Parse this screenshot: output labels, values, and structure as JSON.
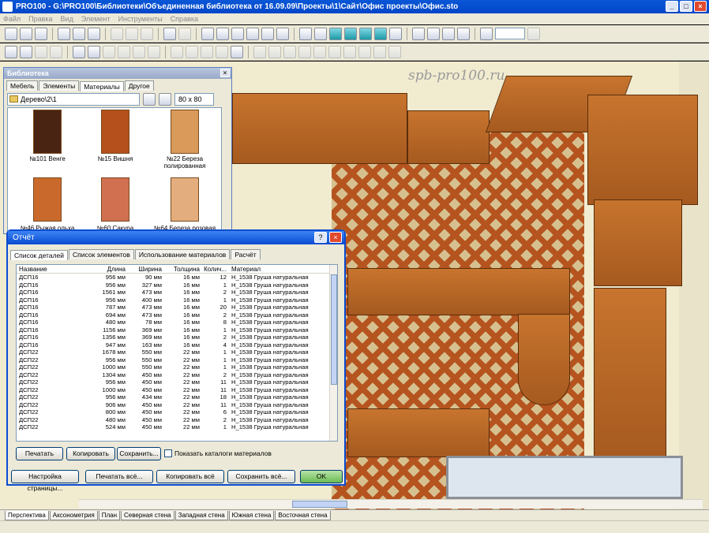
{
  "window": {
    "title": "PRO100 - G:\\PRO100\\Библиотеки\\Объединенная библиотека от 16.09.09\\Проекты\\1\\Сайт\\Офис проекты\\Офис.sto"
  },
  "menu": [
    "Файл",
    "Правка",
    "Вид",
    "Элемент",
    "Инструменты",
    "Справка"
  ],
  "watermark": "spb-pro100.ru",
  "library": {
    "title": "Библиотека",
    "tabs": [
      "Мебель",
      "Элементы",
      "Материалы",
      "Другое"
    ],
    "path": "Дерево\\2\\1",
    "thumb_size": "80 x 80",
    "swatches": [
      {
        "label": "№101 Венге",
        "color": "#4a2412"
      },
      {
        "label": "№15 Вишня",
        "color": "#b5501c"
      },
      {
        "label": "№22 Береза полированная",
        "color": "#d99a5a"
      },
      {
        "label": "№46 Рыжая ольха",
        "color": "#c96a2c"
      },
      {
        "label": "№60 Сакура",
        "color": "#d07050"
      },
      {
        "label": "№64 Береза розовая",
        "color": "#e3ad7e"
      }
    ]
  },
  "report": {
    "title": "Отчёт",
    "tabs": [
      "Список деталей",
      "Список элементов",
      "Использование материалов",
      "Расчёт"
    ],
    "columns": [
      "Название",
      "Длина",
      "Ширина",
      "Толщина",
      "Колич...",
      "Материал"
    ],
    "rows": [
      [
        "ДСП16",
        "956 мм",
        "90 мм",
        "16 мм",
        "12",
        "Н_1538 Груша натуральная"
      ],
      [
        "ДСП16",
        "956 мм",
        "327 мм",
        "16 мм",
        "1",
        "Н_1538 Груша натуральная"
      ],
      [
        "ДСП16",
        "1561 мм",
        "473 мм",
        "16 мм",
        "2",
        "Н_1538 Груша натуральная"
      ],
      [
        "ДСП16",
        "956 мм",
        "400 мм",
        "16 мм",
        "1",
        "Н_1538 Груша натуральная"
      ],
      [
        "ДСП16",
        "787 мм",
        "473 мм",
        "16 мм",
        "20",
        "Н_1538 Груша натуральная"
      ],
      [
        "ДСП16",
        "694 мм",
        "473 мм",
        "16 мм",
        "2",
        "Н_1538 Груша натуральная"
      ],
      [
        "ДСП16",
        "480 мм",
        "78 мм",
        "16 мм",
        "8",
        "Н_1538 Груша натуральная"
      ],
      [
        "ДСП16",
        "1156 мм",
        "369 мм",
        "16 мм",
        "1",
        "Н_1538 Груша натуральная"
      ],
      [
        "ДСП16",
        "1356 мм",
        "369 мм",
        "16 мм",
        "2",
        "Н_1538 Груша натуральная"
      ],
      [
        "ДСП16",
        "947 мм",
        "163 мм",
        "16 мм",
        "4",
        "Н_1538 Груша натуральная"
      ],
      [
        "ДСП22",
        "1678 мм",
        "550 мм",
        "22 мм",
        "1",
        "Н_1538 Груша натуральная"
      ],
      [
        "ДСП22",
        "956 мм",
        "550 мм",
        "22 мм",
        "1",
        "Н_1538 Груша натуральная"
      ],
      [
        "ДСП22",
        "1000 мм",
        "550 мм",
        "22 мм",
        "1",
        "Н_1538 Груша натуральная"
      ],
      [
        "ДСП22",
        "1304 мм",
        "450 мм",
        "22 мм",
        "2",
        "Н_1538 Груша натуральная"
      ],
      [
        "ДСП22",
        "956 мм",
        "450 мм",
        "22 мм",
        "11",
        "Н_1538 Груша натуральная"
      ],
      [
        "ДСП22",
        "1000 мм",
        "450 мм",
        "22 мм",
        "11",
        "Н_1538 Груша натуральная"
      ],
      [
        "ДСП22",
        "956 мм",
        "434 мм",
        "22 мм",
        "18",
        "Н_1538 Груша натуральная"
      ],
      [
        "ДСП22",
        "906 мм",
        "450 мм",
        "22 мм",
        "11",
        "Н_1538 Груша натуральная"
      ],
      [
        "ДСП22",
        "800 мм",
        "450 мм",
        "22 мм",
        "6",
        "Н_1538 Груша натуральная"
      ],
      [
        "ДСП22",
        "480 мм",
        "450 мм",
        "22 мм",
        "2",
        "Н_1538 Груша натуральная"
      ],
      [
        "ДСП22",
        "524 мм",
        "450 мм",
        "22 мм",
        "1",
        "Н_1538 Груша натуральная"
      ]
    ],
    "buttons": {
      "print": "Печатать",
      "copy": "Копировать",
      "save": "Сохранить..."
    },
    "show_catalogs": "Показать каталоги материалов",
    "footer": {
      "page_setup": "Настройка страницы...",
      "print_all": "Печатать всё...",
      "copy_all": "Копировать всё",
      "save_all": "Сохранить всё...",
      "ok": "OK"
    }
  },
  "view_tabs": [
    "Перспектива",
    "Аксонометрия",
    "План",
    "Северная стена",
    "Западная стена",
    "Южная стена",
    "Восточная стена"
  ]
}
